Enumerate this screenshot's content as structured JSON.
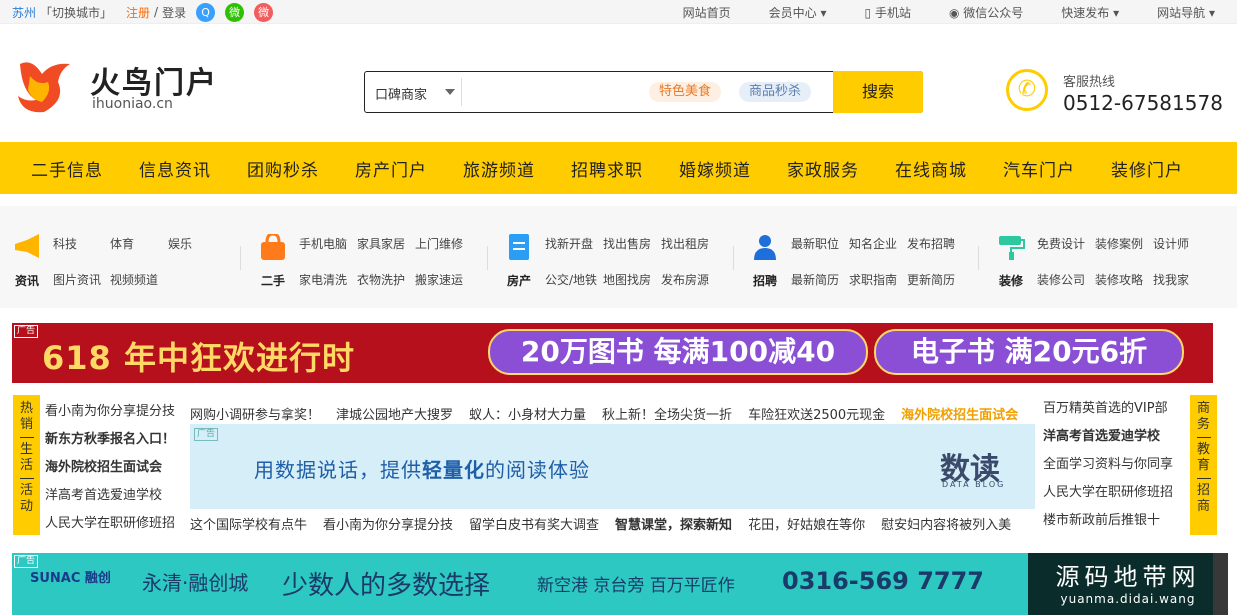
{
  "topbar": {
    "city": "苏州",
    "switch": "「切换城市」",
    "register": "注册",
    "slash": "/",
    "login": "登录",
    "social": [
      {
        "name": "qq",
        "glyph": "Q",
        "color": "#3aa0ff"
      },
      {
        "name": "wechat",
        "glyph": "微",
        "color": "#2dc100"
      },
      {
        "name": "weibo",
        "glyph": "微",
        "color": "#f25c5c"
      }
    ],
    "links": [
      "网站首页",
      "会员中心",
      "手机站",
      "微信公众号",
      "快速发布",
      "网站导航"
    ]
  },
  "logo": {
    "text": "火鸟门户",
    "domain": "ihuoniao.cn"
  },
  "search": {
    "category": "口碑商家",
    "tags": [
      "特色美食",
      "商品秒杀"
    ],
    "button": "搜索"
  },
  "hotline": {
    "label": "客服热线",
    "phone": "0512-67581578"
  },
  "nav": [
    "二手信息",
    "信息资讯",
    "团购秒杀",
    "房产门户",
    "旅游频道",
    "招聘求职",
    "婚嫁频道",
    "家政服务",
    "在线商城",
    "汽车门户",
    "装修门户"
  ],
  "quick": [
    {
      "name": "资讯",
      "links": [
        "科技",
        "体育",
        "娱乐",
        "图片资讯",
        "视频频道"
      ]
    },
    {
      "name": "二手",
      "links": [
        "手机电脑",
        "家具家居",
        "上门维修",
        "家电清洗",
        "衣物洗护",
        "搬家速运"
      ]
    },
    {
      "name": "房产",
      "links": [
        "找新开盘",
        "找出售房",
        "找出租房",
        "公交/地铁",
        "地图找房",
        "发布房源"
      ]
    },
    {
      "name": "招聘",
      "links": [
        "最新职位",
        "知名企业",
        "发布招聘",
        "最新简历",
        "求职指南",
        "更新简历"
      ]
    },
    {
      "name": "装修",
      "links": [
        "免费设计",
        "装修案例",
        "设计师",
        "装修公司",
        "装修攻略",
        "找我家"
      ]
    }
  ],
  "banner": {
    "ad": "广告",
    "left": "618 年中狂欢进行时",
    "mid": "20万图书 每满100减40",
    "right": "电子书 满20元6折"
  },
  "side_left": [
    "热销",
    "生活",
    "活动"
  ],
  "side_right": [
    "商务",
    "教育",
    "招商"
  ],
  "left_list": [
    "看小南为你分享提分技",
    "新东方秋季报名入口！",
    "海外院校招生面试会",
    "洋高考首选爱迪学校",
    "人民大学在职研修班招"
  ],
  "top_row": [
    "网购小调研参与拿奖！",
    "津城公园地产大搜罗",
    "蚁人：小身材大力量",
    "秋上新！全场尖货一折",
    "车险狂欢送2500元现金",
    "海外院校招生面试会"
  ],
  "mid_ad": {
    "ad": "广告",
    "text_a": "用数据说话，提供",
    "text_b": "轻量化",
    "text_c": "的阅读体验",
    "brand": "数读",
    "brand_sub": "DATA BLOG"
  },
  "bottom_row": [
    "这个国际学校有点牛",
    "看小南为你分享提分技",
    "留学白皮书有奖大调查",
    "智慧课堂，探索新知",
    "花田，好姑娘在等你",
    "慰安妇内容将被列入美"
  ],
  "right_list": [
    "百万精英首选的VIP部",
    "洋高考首选爱迪学校",
    "全面学习资料与你同享",
    "人民大学在职研修班招",
    "楼市新政前后推银十"
  ],
  "bottom_ad": {
    "ad": "广告",
    "logo": "SUNAC 融创",
    "t1": "永清·融创城",
    "t2": "少数人的多数选择",
    "t3": "新空港 京台旁 百万平匠作",
    "t4": "0316-569 7777"
  },
  "watermark": {
    "line1": "源码地带网",
    "line2": "yuanma.didai.wang"
  }
}
